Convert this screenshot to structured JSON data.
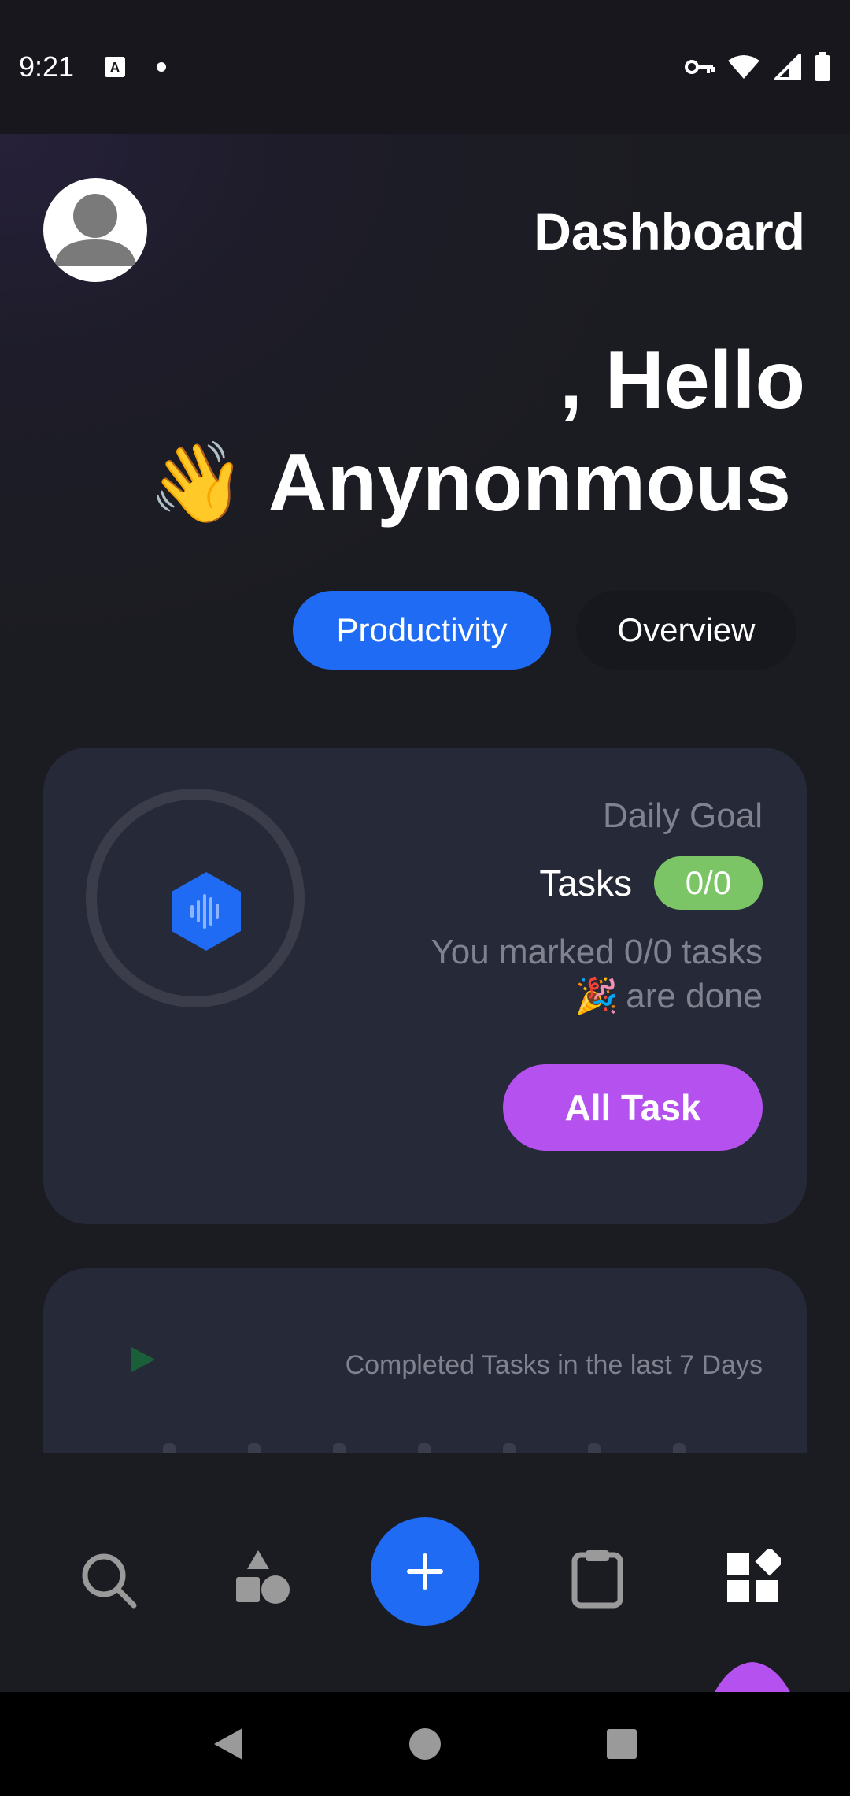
{
  "status_bar": {
    "time": "9:21",
    "icons": [
      "text-notification-icon",
      "dot-icon",
      "vpn-key-icon",
      "wifi-icon",
      "signal-icon",
      "battery-icon"
    ]
  },
  "header": {
    "title": "Dashboard",
    "avatar_icon": "user-avatar-icon"
  },
  "greeting": {
    "line1": ", Hello",
    "name": "Anynonmous",
    "emoji": "👋"
  },
  "tabs": [
    {
      "label": "Productivity",
      "active": true
    },
    {
      "label": "Overview",
      "active": false
    }
  ],
  "goal_card": {
    "title": "Daily Goal",
    "tasks_label": "Tasks",
    "tasks_badge": "0/0",
    "message_line1": "You marked 0/0 tasks",
    "message_line2": "are done",
    "message_emoji": "🎉",
    "button_label": "All Task",
    "center_icon": "voice-hexagon-icon"
  },
  "chart_card": {
    "title": "Completed Tasks in the last 7 Days",
    "play_icon": "play-icon"
  },
  "chart_data": {
    "type": "bar",
    "title": "Completed Tasks in the last 7 Days",
    "categories": [
      "",
      "",
      "",
      "",
      "",
      "",
      ""
    ],
    "values": [
      0,
      0,
      0,
      0,
      0,
      0,
      0
    ]
  },
  "bottom_nav": {
    "items": [
      "search-icon",
      "shapes-icon",
      "add-icon",
      "clipboard-icon",
      "dashboard-icon"
    ],
    "active": "dashboard-icon"
  },
  "system_nav": [
    "back-icon",
    "home-icon",
    "recents-icon"
  ],
  "colors": {
    "accent_blue": "#1f6bf3",
    "accent_purple": "#b551ef",
    "success_green": "#7cc566",
    "card_bg": "#262938",
    "app_bg": "#1b1c21"
  }
}
